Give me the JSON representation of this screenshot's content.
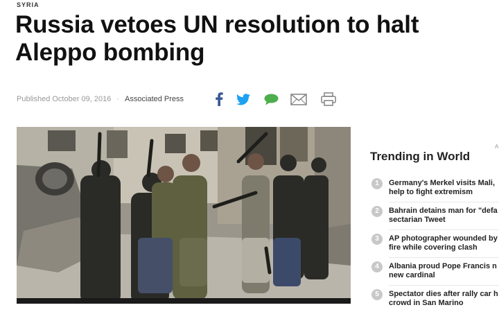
{
  "article": {
    "section": "SYRIA",
    "headline": "Russia vetoes UN resolution to halt Aleppo bombing",
    "published": "Published October 09, 2016",
    "separator": "·",
    "source": "Associated Press"
  },
  "share": {
    "icons": [
      "facebook-icon",
      "twitter-icon",
      "comment-icon",
      "email-icon",
      "print-icon"
    ],
    "colors": {
      "facebook": "#3b5998",
      "twitter": "#1da1f2",
      "comment": "#4cae4c",
      "email": "#888888",
      "print": "#888888"
    }
  },
  "sidebar": {
    "ad_mark": "A",
    "title": "Trending in World",
    "items": [
      {
        "num": "1",
        "text": "Germany's Merkel visits Mali,\nhelp to fight extremism"
      },
      {
        "num": "2",
        "text": "Bahrain detains man for \"defa\nsectarian Tweet"
      },
      {
        "num": "3",
        "text": "AP photographer wounded by\nfire while covering clash"
      },
      {
        "num": "4",
        "text": "Albania proud Pope Francis n\nnew cardinal"
      },
      {
        "num": "5",
        "text": "Spectator dies after rally car h\ncrowd in San Marino"
      }
    ]
  }
}
